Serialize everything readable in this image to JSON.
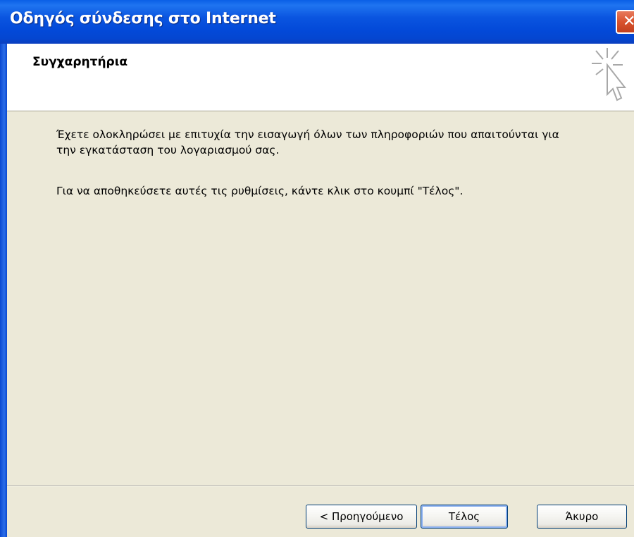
{
  "window": {
    "title": "Οδηγός σύνδεσης στο Internet",
    "close_icon": "close-icon"
  },
  "header": {
    "title": "Συγχαρητήρια",
    "icon": "wizard-cursor-icon"
  },
  "content": {
    "paragraph1": "Έχετε ολοκληρώσει με επιτυχία την εισαγωγή όλων των πληροφοριών που απαιτούνται για την εγκατάσταση του λογαριασμού σας.",
    "paragraph2": "Για να αποθηκεύσετε αυτές τις ρυθμίσεις, κάντε κλικ στο κουμπί \"Τέλος\"."
  },
  "buttons": {
    "back": "< Προηγούμενο",
    "finish": "Τέλος",
    "cancel": "Άκυρο"
  },
  "colors": {
    "titlebar": "#0a55e0",
    "face": "#ece9d8",
    "close_button": "#d9532e"
  }
}
